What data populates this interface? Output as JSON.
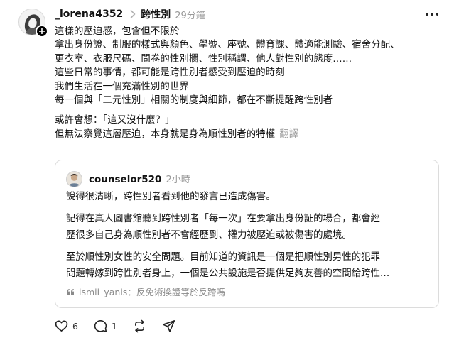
{
  "post": {
    "username": "_lorena4352",
    "topic": "跨性別",
    "time": "29分鐘",
    "lines": [
      "這樣的壓迫感，包含但不限於",
      "拿出身份證、制服的樣式與顏色、學號、座號、體育課、體適能測驗、宿舍分配、",
      "更衣室、衣服尺碼、問卷的性別欄、性別稱謂、他人對性別的態度……",
      "這些日常的事情，都可能是跨性別者感受到壓迫的時刻",
      "我們生活在一個充滿性別的世界",
      "每一個與「二元性別」相關的制度與細節，都在不斷提醒跨性別者"
    ],
    "lines2": [
      "或許會想：「這又沒什麼？」",
      "但無法察覺這層壓迫，本身就是身為順性別者的特權"
    ],
    "translate_label": "翻譯"
  },
  "quote": {
    "username": "counselor520",
    "time": "2小時",
    "para1": "說得很清晰，跨性別者看到他的發言已造成傷害。",
    "para2": [
      "記得在真人圖書館聽到跨性別者「每一次」在要拿出身份証的場合，都會經",
      "歷很多自己身為順性別者不會經歷到、權力被壓迫或被傷害的處境。"
    ],
    "para3": [
      "至於順性別女性的安全問題。目前知道的資訊是一個是把順性別男性的犯罪",
      "問題轉嫁到跨性別者身上，一個是公共設施是否提供足夠友善的空間給跨性…"
    ],
    "reply_text": "ismii_yanis：反免術換證等於反跨嗎"
  },
  "actions": {
    "likes": "6",
    "replies": "1",
    "reposts": "",
    "shares": ""
  },
  "icons": {
    "like": "heart-icon",
    "reply": "comment-icon",
    "repost": "repost-icon",
    "share": "send-icon",
    "more": "more-icon",
    "follow": "plus-icon",
    "chevron": "chevron-right-icon",
    "reply_quote": "quote-icon"
  }
}
